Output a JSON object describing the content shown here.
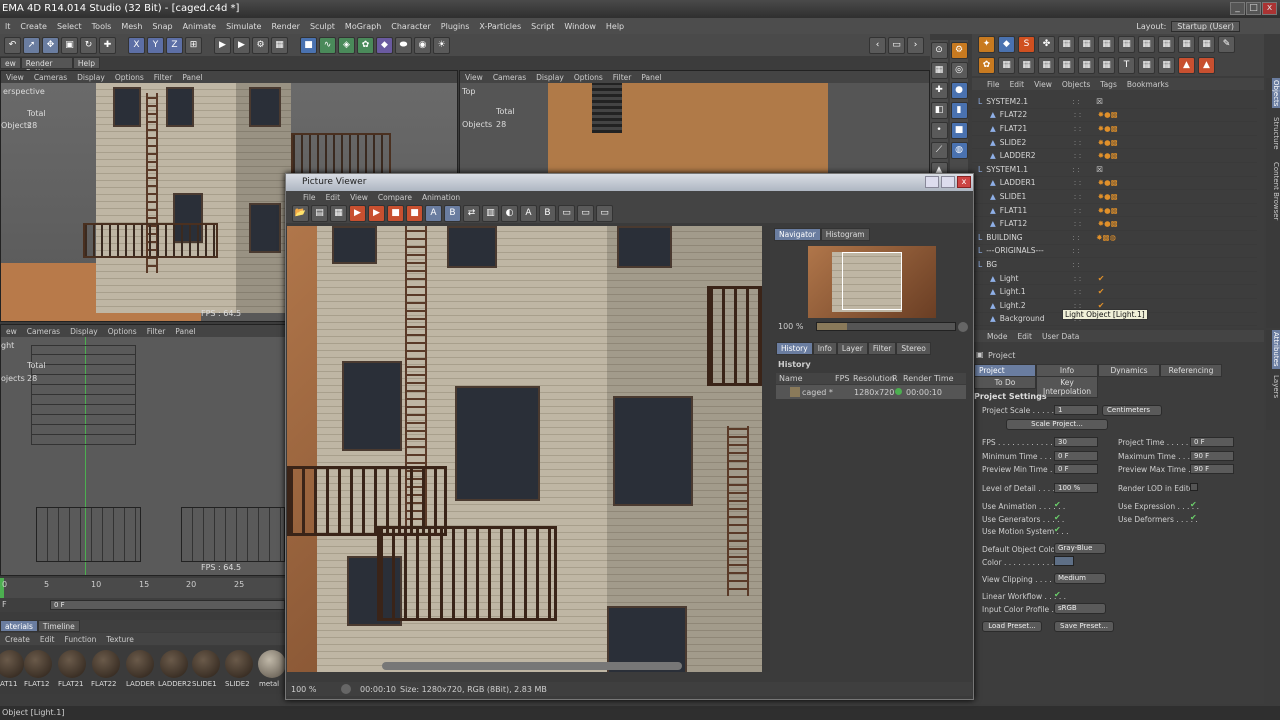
{
  "app": {
    "title": "EMA 4D R14.014 Studio (32 Bit) - [caged.c4d *]",
    "layout_label": "Layout:",
    "layout_value": "Startup (User)"
  },
  "menu": [
    "lt",
    "Create",
    "Select",
    "Tools",
    "Mesh",
    "Snap",
    "Animate",
    "Simulate",
    "Render",
    "Sculpt",
    "MoGraph",
    "Character",
    "Plugins",
    "X-Particles",
    "Script",
    "Window",
    "Help"
  ],
  "left_tabs": [
    "ew",
    "Render Settings",
    "Help"
  ],
  "viewport_tl": {
    "menu": [
      "View",
      "Cameras",
      "Display",
      "Options",
      "Filter",
      "Panel"
    ],
    "name": "erspective",
    "total": "Total",
    "objects_label": "Objects",
    "objects_value": "28",
    "fps": "FPS : 64.5"
  },
  "viewport_tr": {
    "menu": [
      "View",
      "Cameras",
      "Display",
      "Options",
      "Filter",
      "Panel"
    ],
    "name": "Top",
    "total": "Total",
    "objects_label": "Objects",
    "objects_value": "28"
  },
  "viewport_bl": {
    "menu": [
      "ew",
      "Cameras",
      "Display",
      "Options",
      "Filter",
      "Panel"
    ],
    "name": "ght",
    "total": "Total",
    "objects_label": "ojects",
    "objects_value": "28",
    "fps": "FPS : 64.5"
  },
  "timeline": {
    "ticks": [
      "0",
      "5",
      "10",
      "15",
      "20",
      "25"
    ],
    "current": "F",
    "field": "0 F"
  },
  "materials": {
    "tabs": [
      "aterials",
      "Timeline"
    ],
    "menu": [
      "Create",
      "Edit",
      "Function",
      "Texture"
    ],
    "items": [
      "AT11",
      "FLAT12",
      "FLAT21",
      "FLAT22",
      "LADDER",
      "LADDER2",
      "SLIDE1",
      "SLIDE2",
      "metal"
    ]
  },
  "status": "Object [Light.1]",
  "picture_viewer": {
    "title": "Picture Viewer",
    "menu": [
      "File",
      "Edit",
      "View",
      "Compare",
      "Animation"
    ],
    "nav_tabs": [
      "Navigator",
      "Histogram"
    ],
    "zoom": "100 %",
    "info_tabs": [
      "History",
      "Info",
      "Layer",
      "Filter",
      "Stereo"
    ],
    "history_title": "History",
    "columns": [
      "Name",
      "FPS",
      "Resolution",
      "R",
      "Render Time"
    ],
    "row": {
      "name": "caged *",
      "resolution": "1280x720",
      "time": "00:00:10"
    },
    "bottom_zoom": "100 %",
    "bottom_time": "00:00:10",
    "size_info": "Size: 1280x720, RGB (8Bit), 2.83 MB"
  },
  "object_manager": {
    "menu": [
      "File",
      "Edit",
      "View",
      "Objects",
      "Tags",
      "Bookmarks"
    ],
    "items": [
      {
        "name": "SYSTEM2.1",
        "indent": 0
      },
      {
        "name": "FLAT22",
        "indent": 1
      },
      {
        "name": "FLAT21",
        "indent": 1
      },
      {
        "name": "SLIDE2",
        "indent": 1
      },
      {
        "name": "LADDER2",
        "indent": 1
      },
      {
        "name": "SYSTEM1.1",
        "indent": 0
      },
      {
        "name": "LADDER1",
        "indent": 1
      },
      {
        "name": "SLIDE1",
        "indent": 1
      },
      {
        "name": "FLAT11",
        "indent": 1
      },
      {
        "name": "FLAT12",
        "indent": 1
      },
      {
        "name": "BUILDING",
        "indent": 0
      },
      {
        "name": "---ORIGINALS---",
        "indent": 0
      },
      {
        "name": "BG",
        "indent": 0
      },
      {
        "name": "Light",
        "indent": 1
      },
      {
        "name": "Light.1",
        "indent": 1
      },
      {
        "name": "Light.2",
        "indent": 1
      },
      {
        "name": "Background",
        "indent": 1
      }
    ],
    "tooltip": "Light Object [Light.1]",
    "side_tabs": [
      "Objects",
      "Structure",
      "Content Browser"
    ]
  },
  "attributes": {
    "menu": [
      "Mode",
      "Edit",
      "User Data"
    ],
    "object": "Project",
    "tabs_row1": [
      "Project Settings",
      "Info",
      "Dynamics",
      "Referencing"
    ],
    "tabs_row2": [
      "To Do",
      "Key Interpolation"
    ],
    "section": "Project Settings",
    "project_scale_label": "Project Scale . . . . . .",
    "project_scale_value": "1",
    "units": "Centimeters",
    "scale_button": "Scale Project...",
    "fps_label": "FPS . . . . . . . . . . . . . .",
    "fps_value": "30",
    "project_time_label": "Project Time . . . . . . .",
    "project_time_value": "0 F",
    "min_time_label": "Minimum Time . . . . . .",
    "min_time_value": "0 F",
    "max_time_label": "Maximum Time . . . . . .",
    "max_time_value": "90 F",
    "prev_min_label": "Preview Min Time . . .",
    "prev_min_value": "0 F",
    "prev_max_label": "Preview Max Time . . .",
    "prev_max_value": "90 F",
    "lod_label": "Level of Detail . . . . . .",
    "lod_value": "100 %",
    "render_lod_label": "Render LOD in Editor",
    "use_anim": "Use Animation . . . . . .",
    "use_expr": "Use Expression . . . . .",
    "use_gen": "Use Generators . . . . .",
    "use_def": "Use Deformers . . . . .",
    "use_motion": "Use Motion System . . .",
    "default_color_label": "Default Object Color",
    "default_color_value": "Gray-Blue",
    "color_label": "Color . . . . . . . . . . . . .",
    "clipping_label": "View Clipping . . . . . . .",
    "clipping_value": "Medium",
    "linear_label": "Linear Workflow . . . . .",
    "profile_label": "Input Color Profile . . .",
    "profile_value": "sRGB",
    "load_preset": "Load Preset...",
    "save_preset": "Save Preset...",
    "side_tabs": [
      "Attributes",
      "Layers"
    ]
  }
}
